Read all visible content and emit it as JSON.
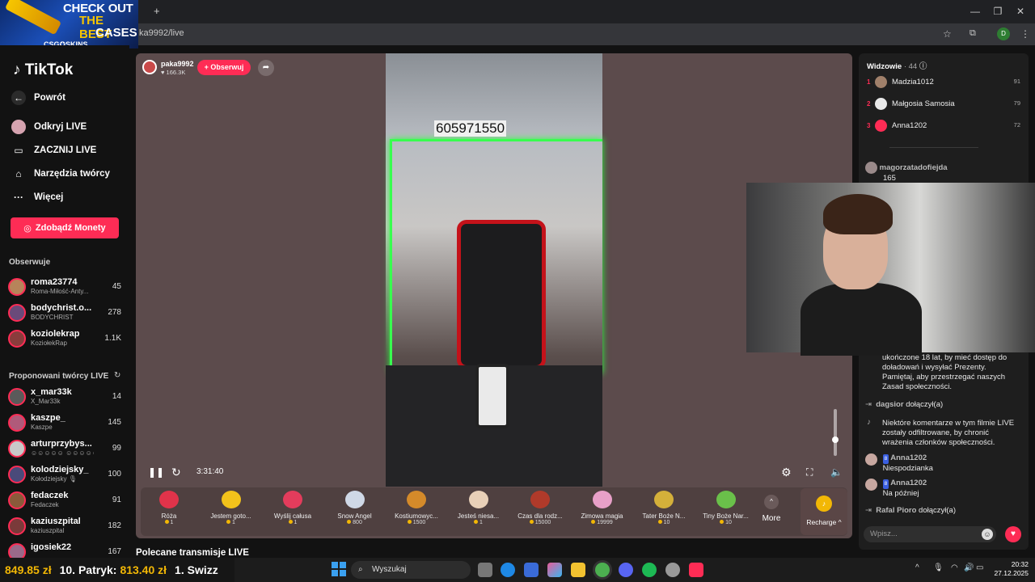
{
  "browser": {
    "url": "ka9992/live",
    "profile_initial": "D",
    "new_tab_symbol": "+"
  },
  "ad": {
    "line1": "CHECK OUT",
    "line2": "THE BEST",
    "line3": "CASES",
    "brand": "CSG✪SKINS"
  },
  "sidebar": {
    "logo": "TikTok",
    "nav": [
      {
        "label": "Powrót",
        "icon": "back-arrow-icon"
      },
      {
        "label": "Odkryj LIVE",
        "icon": "live-icon"
      },
      {
        "label": "ZACZNIJ LIVE",
        "icon": "camera-icon"
      },
      {
        "label": "Narzędzia twórcy",
        "icon": "home-icon"
      },
      {
        "label": "Więcej",
        "icon": "more-icon"
      }
    ],
    "coins_button": "Zdobądź Monety",
    "following_title": "Obserwuje",
    "following": [
      {
        "name": "roma23774",
        "sub": "Roma-Miłość-Anty...",
        "count": "45",
        "color": "#b7845a"
      },
      {
        "name": "bodychrist.o...",
        "sub": "BODYCHRIST",
        "count": "278",
        "color": "#6a4a7a"
      },
      {
        "name": "koziolekrap",
        "sub": "KoziołekRap",
        "count": "1.1K",
        "color": "#8a3c3c"
      }
    ],
    "suggested_title": "Proponowani twórcy LIVE",
    "suggested": [
      {
        "name": "x_mar33k",
        "sub": "X_Mar33k",
        "count": "14",
        "color": "#5a5a5a"
      },
      {
        "name": "kaszpe_",
        "sub": "Kaszpe",
        "count": "145",
        "color": "#b05a7a"
      },
      {
        "name": "arturprzybys...",
        "sub": "☺☺☺☺☺ ☺☺☺☺☺",
        "count": "99",
        "color": "#c9c9c9"
      },
      {
        "name": "kolodziejsky_",
        "sub": "Kołodziejsky 🎙",
        "count": "100",
        "color": "#4a4a7a"
      },
      {
        "name": "fedaczek",
        "sub": "Fedaczek",
        "count": "91",
        "color": "#8a5a3a"
      },
      {
        "name": "kaziuszpital",
        "sub": "kaziuszpital",
        "count": "182",
        "color": "#7a3a3a"
      },
      {
        "name": "igosiek22",
        "sub": "",
        "count": "167",
        "color": "#9a6a8a"
      }
    ]
  },
  "stream": {
    "host": "paka9992",
    "likes": "166.3K",
    "follow": "+ Obserwuj",
    "sign": "605971550",
    "time": "3:31:40"
  },
  "gifts": [
    {
      "name": "Róża",
      "price": "1",
      "color": "#e0334a"
    },
    {
      "name": "Jestem goto...",
      "price": "1",
      "color": "#f2c21b"
    },
    {
      "name": "Wyślij całusa",
      "price": "1",
      "color": "#e33c5c"
    },
    {
      "name": "Snow Angel",
      "price": "800",
      "color": "#cfd8e6"
    },
    {
      "name": "Kostiumowyc...",
      "price": "1500",
      "color": "#d48a2a"
    },
    {
      "name": "Jesteś niesa...",
      "price": "1",
      "color": "#e8d0b8"
    },
    {
      "name": "Czas dla rodz...",
      "price": "15000",
      "color": "#b03a2a"
    },
    {
      "name": "Zimowa magia",
      "price": "19999",
      "color": "#e8a0c8"
    },
    {
      "name": "Tater Boże N...",
      "price": "10",
      "color": "#d4b03a"
    },
    {
      "name": "Tiny Boże Nar...",
      "price": "10",
      "color": "#6ac04a"
    }
  ],
  "gift_more": "More",
  "recharge": "Recharge",
  "below_title": "Polecane transmisje LIVE",
  "viewers": {
    "title": "Widzowie",
    "count": "· 44",
    "ranks": [
      {
        "rank": "1",
        "name": "Madzia1012",
        "score": "91",
        "color": "#a0806a"
      },
      {
        "rank": "2",
        "name": "Małgosia Samosia",
        "score": "79",
        "color": "#e8e8e8"
      },
      {
        "rank": "3",
        "name": "Anna1202",
        "score": "72",
        "color": "#fe2c55"
      }
    ]
  },
  "chat": {
    "top_user": "magorzatadofiejda",
    "top_value": "165",
    "age_notice": "ukończone 18 lat, by mieć dostęp do doładowań i wysyłać Prezenty. Pamiętaj, aby przestrzegać naszych Zasad społeczności.",
    "join1_user": "dagsior",
    "joined": "dołączył(a)",
    "filter_notice": "Niektóre komentarze w tym filmie LIVE zostały odfiltrowane, by chronić wrażenia członków społeczności.",
    "m1_user": "Anna1202",
    "m1_text": "Niespodzianka",
    "badge": "8",
    "m2_user": "Anna1202",
    "m2_text": "Na później",
    "join2_user": "Rafal Pioro",
    "input_placeholder": "Wpisz..."
  },
  "ticker": {
    "amount": "849.85 zł",
    "item2": "10. Patryk:",
    "item2_amount": "813.40 zł",
    "item3": "1. Swizz"
  },
  "taskbar": {
    "search": "Wyszukaj",
    "time": "20:32",
    "date": "27.12.2025"
  }
}
